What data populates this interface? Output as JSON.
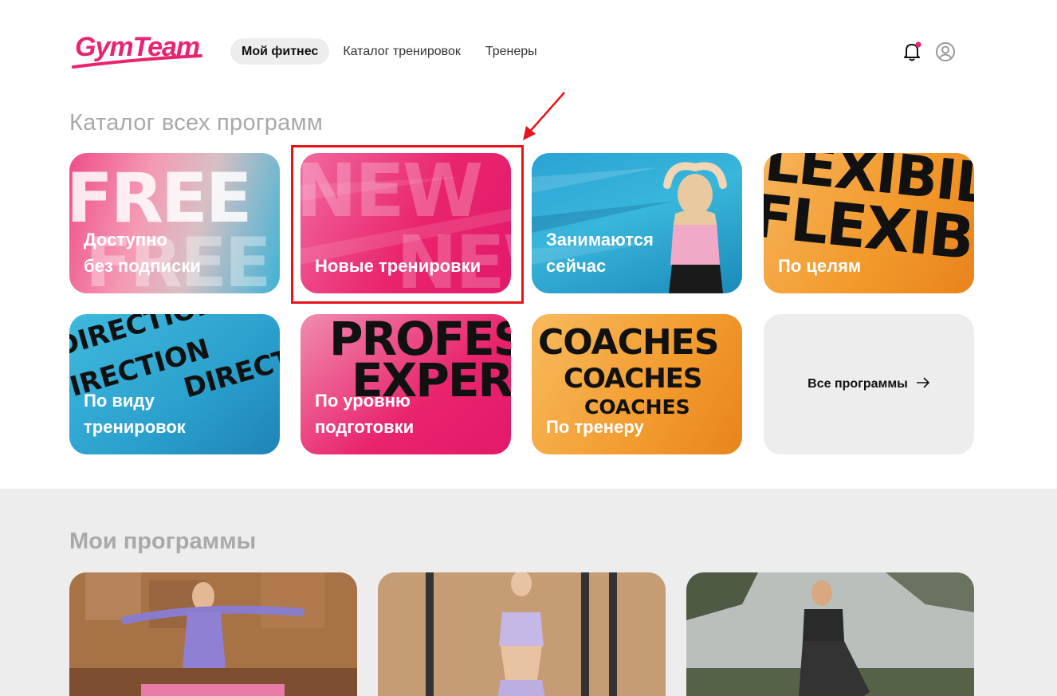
{
  "brand": {
    "logo_text": "GymTeam",
    "accent": "#e8236f"
  },
  "nav": {
    "items": [
      "Мой фитнес",
      "Каталог тренировок",
      "Тренеры"
    ],
    "active": 0
  },
  "header": {
    "bell_icon": "bell-icon",
    "user_icon": "user-icon",
    "notification_dot": "#e8236f"
  },
  "catalog": {
    "title": "Каталог всех программ",
    "cards": [
      {
        "line1": "Доступно",
        "line2": "без подписки",
        "art": "FREE"
      },
      {
        "line1": "",
        "line2": "Новые тренировки",
        "art": "NEW"
      },
      {
        "line1": "Занимаются",
        "line2": "сейчас"
      },
      {
        "line1": "",
        "line2": "По целям",
        "art": "FLEXIBILITY"
      },
      {
        "line1": "По виду",
        "line2": "тренировок",
        "art": "DIRECTION"
      },
      {
        "line1": "По уровню",
        "line2": "подготовки",
        "art": "PROFESSIONAL EXPERT"
      },
      {
        "line1": "",
        "line2": "По тренеру",
        "art": "COACHES"
      }
    ],
    "all_programs": "Все программы"
  },
  "mine": {
    "title": "Мои программы"
  }
}
